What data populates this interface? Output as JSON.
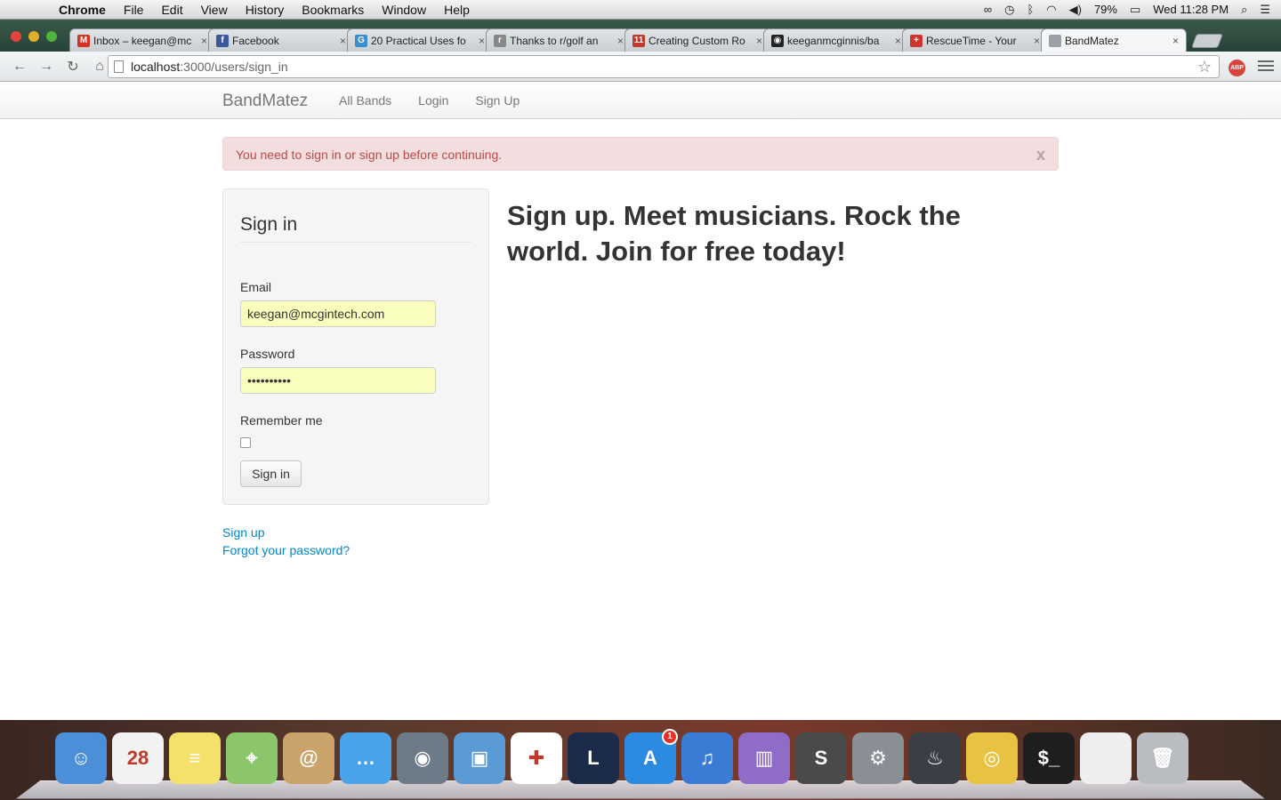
{
  "menubar": {
    "app_name": "Chrome",
    "menus": [
      "File",
      "Edit",
      "View",
      "History",
      "Bookmarks",
      "Window",
      "Help"
    ],
    "battery": "79%",
    "clock": "Wed 11:28 PM"
  },
  "browser": {
    "tabs": [
      {
        "title": "Inbox – keegan@mc",
        "icon": "gmail-icon",
        "color": "#d93025",
        "glyph": "M"
      },
      {
        "title": "Facebook",
        "icon": "facebook-icon",
        "color": "#3b5998",
        "glyph": "f"
      },
      {
        "title": "20 Practical Uses fo",
        "icon": "article-icon",
        "color": "#3a8ed0",
        "glyph": "G"
      },
      {
        "title": "Thanks to r/golf an",
        "icon": "reddit-icon",
        "color": "#888888",
        "glyph": "r"
      },
      {
        "title": "Creating Custom Ro",
        "icon": "calendar-icon",
        "color": "#c0392b",
        "glyph": "11"
      },
      {
        "title": "keeganmcginnis/ba",
        "icon": "github-icon",
        "color": "#222222",
        "glyph": "◉"
      },
      {
        "title": "RescueTime - Your",
        "icon": "rescuetime-icon",
        "color": "#d0342c",
        "glyph": "+"
      },
      {
        "title": "BandMatez",
        "icon": "page-icon",
        "color": "#9aa0a6",
        "glyph": ""
      }
    ],
    "url_host": "localhost",
    "url_path": ":3000/users/sign_in",
    "extension_label": "ABP"
  },
  "page": {
    "brand": "BandMatez",
    "nav": [
      "All Bands",
      "Login",
      "Sign Up"
    ],
    "alert": "You need to sign in or sign up before continuing.",
    "alert_close": "x",
    "form": {
      "title": "Sign in",
      "email_label": "Email",
      "email_value": "keegan@mcgintech.com",
      "password_label": "Password",
      "password_value": "••••••••••",
      "remember_label": "Remember me",
      "remember_checked": false,
      "submit_label": "Sign in"
    },
    "links": [
      "Sign up",
      "Forgot your password?"
    ],
    "headline": "Sign up. Meet musicians. Rock the world. Join for free today!"
  },
  "dock": {
    "items": [
      {
        "name": "finder",
        "color": "#4a8fd8",
        "glyph": "☺"
      },
      {
        "name": "calendar",
        "color": "#f2f2f2",
        "glyph": "28"
      },
      {
        "name": "stickies",
        "color": "#f3e16b",
        "glyph": "≡"
      },
      {
        "name": "maps",
        "color": "#8cc66a",
        "glyph": "⌖"
      },
      {
        "name": "contacts",
        "color": "#c9a36a",
        "glyph": "@"
      },
      {
        "name": "messages",
        "color": "#4aa3e8",
        "glyph": "…"
      },
      {
        "name": "facetime",
        "color": "#6d7b88",
        "glyph": "◉"
      },
      {
        "name": "iphoto",
        "color": "#5a9bd5",
        "glyph": "▣"
      },
      {
        "name": "clock-app",
        "color": "#ffffff",
        "glyph": "✚"
      },
      {
        "name": "league-of-legends",
        "color": "#1d2b4a",
        "glyph": "L"
      },
      {
        "name": "app-store",
        "color": "#2a8be0",
        "glyph": "A",
        "badge": "1"
      },
      {
        "name": "itunes",
        "color": "#3a7bd5",
        "glyph": "♫"
      },
      {
        "name": "keynote",
        "color": "#8e6cc8",
        "glyph": "▥"
      },
      {
        "name": "sublime-text",
        "color": "#4a4a4a",
        "glyph": "S"
      },
      {
        "name": "system-preferences",
        "color": "#8a8f96",
        "glyph": "⚙"
      },
      {
        "name": "steam",
        "color": "#3a3f45",
        "glyph": "♨"
      },
      {
        "name": "chrome",
        "color": "#e8c341",
        "glyph": "◎"
      },
      {
        "name": "terminal",
        "color": "#1e1e1e",
        "glyph": "$_"
      },
      {
        "name": "document",
        "color": "#eeeeee",
        "glyph": ""
      },
      {
        "name": "trash",
        "color": "#b9bcc0",
        "glyph": "🗑"
      }
    ]
  }
}
